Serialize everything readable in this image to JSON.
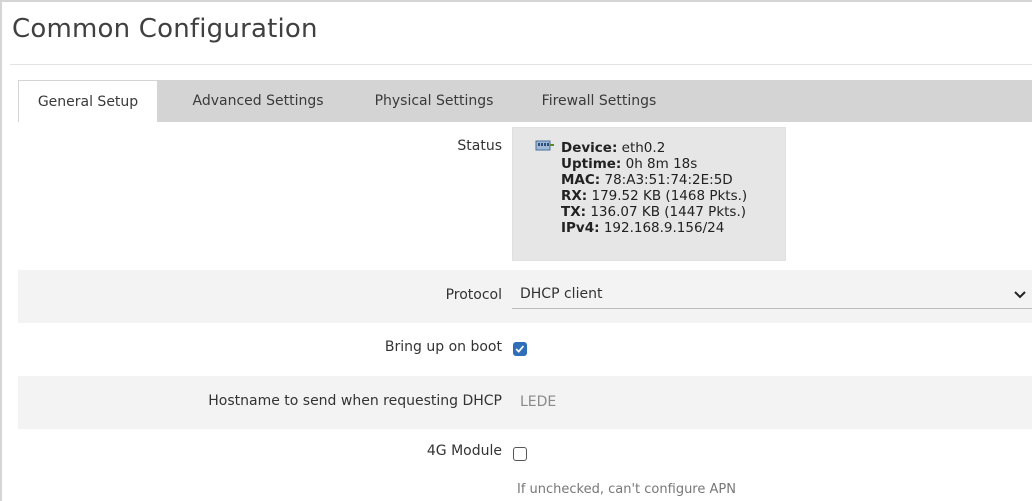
{
  "page": {
    "title": "Common Configuration"
  },
  "tabs": [
    {
      "label": "General Setup",
      "active": true
    },
    {
      "label": "Advanced Settings",
      "active": false
    },
    {
      "label": "Physical Settings",
      "active": false
    },
    {
      "label": "Firewall Settings",
      "active": false
    }
  ],
  "status": {
    "label": "Status",
    "icon": "network-port-icon",
    "device_key": "Device:",
    "device_val": "eth0.2",
    "uptime_key": "Uptime:",
    "uptime_val": "0h 8m 18s",
    "mac_key": "MAC:",
    "mac_val": "78:A3:51:74:2E:5D",
    "rx_key": "RX:",
    "rx_val": "179.52 KB (1468 Pkts.)",
    "tx_key": "TX:",
    "tx_val": "136.07 KB (1447 Pkts.)",
    "ipv4_key": "IPv4:",
    "ipv4_val": "192.168.9.156/24"
  },
  "protocol": {
    "label": "Protocol",
    "value": "DHCP client"
  },
  "boot": {
    "label": "Bring up on boot",
    "checked": true
  },
  "hostname": {
    "label": "Hostname to send when requesting DHCP",
    "placeholder": "LEDE"
  },
  "module4g": {
    "label": "4G Module",
    "checked": false,
    "help": "If unchecked, can't configure APN"
  },
  "colors": {
    "tabbar": "#d4d4d4",
    "checkbox_accent": "#2f6eb8",
    "status_bg": "#e6e6e6"
  }
}
